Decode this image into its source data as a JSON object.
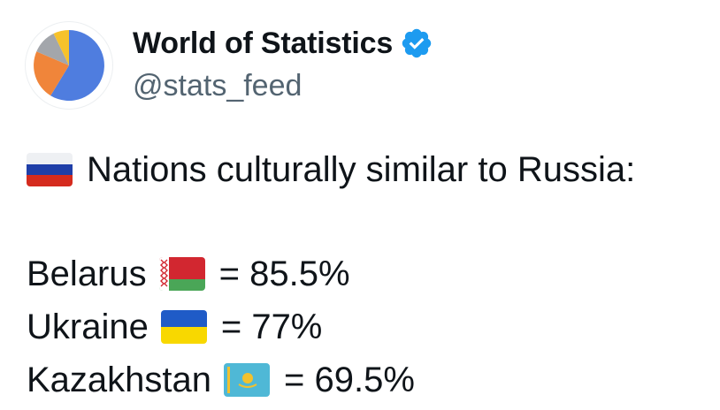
{
  "account": {
    "display_name": "World of Statistics",
    "handle": "@stats_feed",
    "verified": true,
    "verified_color": "#1d9bf0",
    "avatar_icon": "pie-chart-icon"
  },
  "tweet": {
    "headline_flag": "russia-flag-icon",
    "headline_text": "Nations culturally similar to Russia:",
    "rows": [
      {
        "country": "Belarus",
        "flag": "belarus-flag-icon",
        "value_text": "= 85.5%"
      },
      {
        "country": "Ukraine",
        "flag": "ukraine-flag-icon",
        "value_text": "= 77%"
      },
      {
        "country": "Kazakhstan",
        "flag": "kazakhstan-flag-icon",
        "value_text": "= 69.5%"
      }
    ]
  }
}
